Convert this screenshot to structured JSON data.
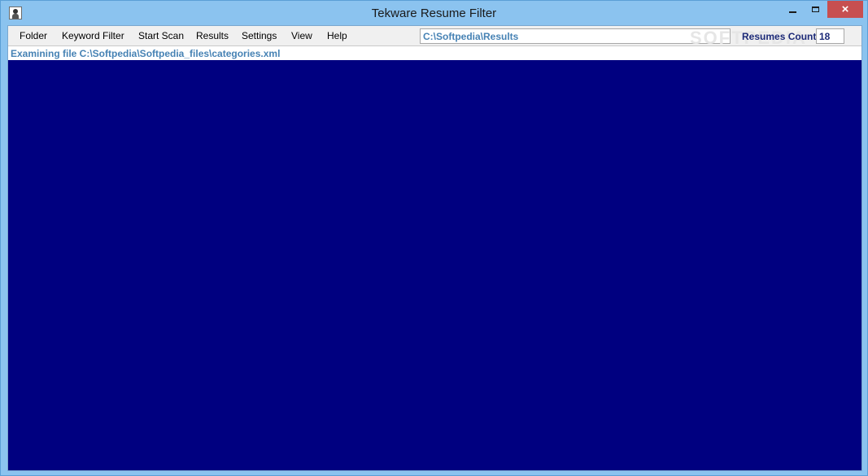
{
  "window": {
    "title": "Tekware Resume Filter",
    "icon": "person-icon",
    "controls": {
      "minimize": "minimize-icon",
      "maximize": "maximize-icon",
      "close": "×"
    }
  },
  "menu": {
    "items": [
      {
        "label": "Folder"
      },
      {
        "label": "Keyword Filter"
      },
      {
        "label": "Start Scan"
      },
      {
        "label": "Results"
      },
      {
        "label": "Settings"
      },
      {
        "label": "View"
      },
      {
        "label": "Help"
      }
    ]
  },
  "toolbar": {
    "results_path": "C:\\Softpedia\\Results",
    "watermark": "SOFTPEDIA",
    "resumes_count_label": "Resumes Count",
    "resumes_count_value": "18"
  },
  "status": {
    "text": "Examining file C:\\Softpedia\\Softpedia_files\\categories.xml"
  },
  "colors": {
    "titlebar": "#8bc3ef",
    "output_background": "#000080",
    "path_text": "#4682b4",
    "count_text": "#1c2a78",
    "close_button": "#c74f50"
  }
}
